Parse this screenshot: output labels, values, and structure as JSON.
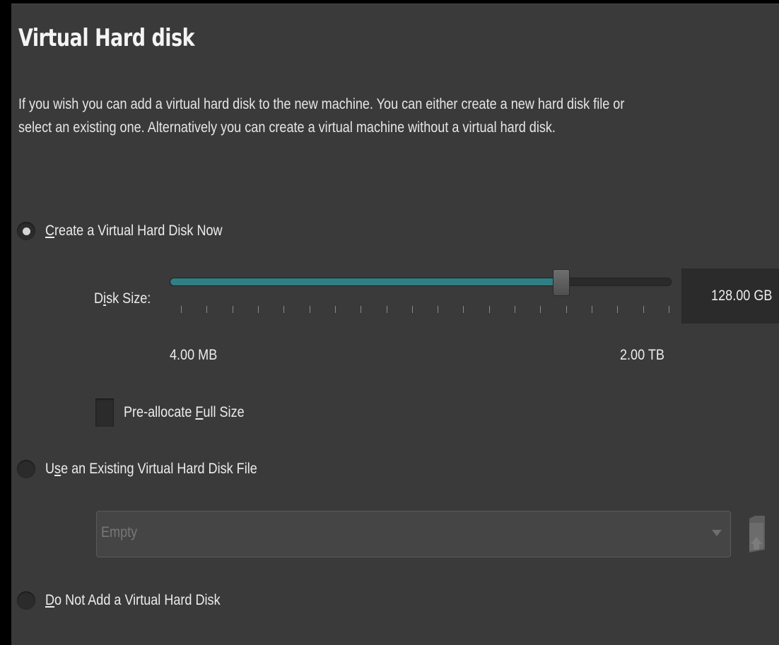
{
  "page": {
    "title": "Virtual Hard disk",
    "description": "If you wish you can add a virtual hard disk to the new machine. You can either create a new hard disk file or select an existing one. Alternatively you can create a virtual machine without a virtual hard disk."
  },
  "options": {
    "create_now": {
      "prefix": "",
      "mnemonic": "C",
      "suffix": "reate a Virtual Hard Disk Now",
      "selected": true
    },
    "use_existing": {
      "prefix": "U",
      "mnemonic": "s",
      "suffix": "e an Existing Virtual Hard Disk File",
      "selected": false
    },
    "do_not_add": {
      "prefix": "",
      "mnemonic": "D",
      "suffix": "o Not Add a Virtual Hard Disk",
      "selected": false
    }
  },
  "disk_size": {
    "label_prefix": "D",
    "label_mnemonic": "i",
    "label_suffix": "sk Size:",
    "value": "128.00 GB",
    "min_label": "4.00 MB",
    "max_label": "2.00 TB",
    "slider_fraction": 0.78,
    "tick_count": 20
  },
  "preallocate": {
    "prefix": "Pre-allocate ",
    "mnemonic": "F",
    "suffix": "ull Size",
    "checked": false
  },
  "existing_file": {
    "value": "Empty",
    "enabled": false
  },
  "icons": {
    "folder_button": "folder-open-icon",
    "combo_arrow": "chevron-down-icon"
  },
  "colors": {
    "slider_fill": "#2f7f84",
    "panel_bg": "#3a3a3a"
  }
}
